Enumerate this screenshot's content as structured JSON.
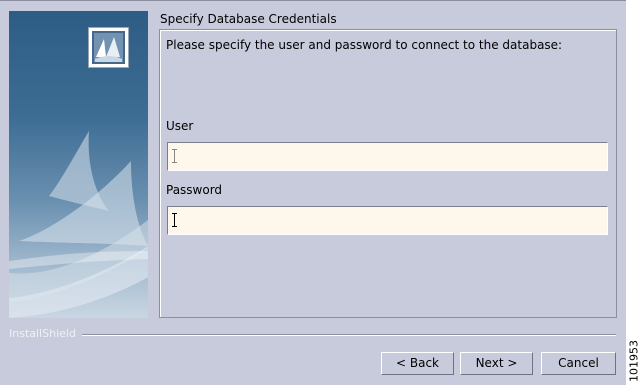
{
  "wizard": {
    "section_title": "Specify Database Credentials",
    "instruction": "Please specify the user and password to connect to the database:",
    "user": {
      "label": "User",
      "value": "",
      "placeholder": ""
    },
    "password": {
      "label": "Password",
      "value": "",
      "placeholder": ""
    }
  },
  "footer": {
    "brand": "InstallShield",
    "buttons": {
      "back": "< Back",
      "next": "Next >",
      "cancel": "Cancel"
    }
  },
  "figure_number": "101953",
  "icons": {
    "logo": "installer-logo-icon",
    "cursor": "text-cursor-icon"
  },
  "colors": {
    "window_background": "#c8cbdc",
    "input_background": "#fdf7ec",
    "side_panel_top": "#2d5c84",
    "side_panel_bottom": "#c9d6e2",
    "brand_text": "#eef0f6"
  }
}
